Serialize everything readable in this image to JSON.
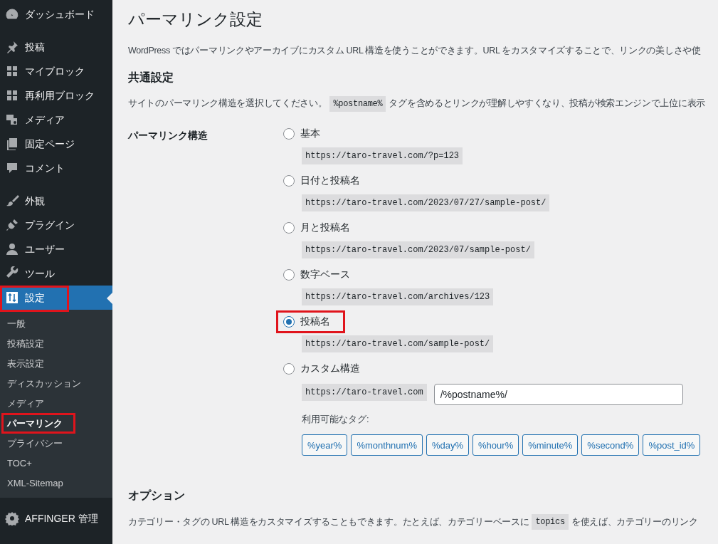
{
  "sidebar": {
    "groups": [
      [
        {
          "label": "ダッシュボード",
          "selected": false,
          "highlighted": false
        }
      ],
      [
        {
          "label": "投稿",
          "selected": false,
          "highlighted": false
        },
        {
          "label": "マイブロック",
          "selected": false,
          "highlighted": false
        },
        {
          "label": "再利用ブロック",
          "selected": false,
          "highlighted": false
        },
        {
          "label": "メディア",
          "selected": false,
          "highlighted": false
        },
        {
          "label": "固定ページ",
          "selected": false,
          "highlighted": false
        },
        {
          "label": "コメント",
          "selected": false,
          "highlighted": false
        }
      ],
      [
        {
          "label": "外観",
          "selected": false,
          "highlighted": false
        },
        {
          "label": "プラグイン",
          "selected": false,
          "highlighted": false
        },
        {
          "label": "ユーザー",
          "selected": false,
          "highlighted": false
        },
        {
          "label": "ツール",
          "selected": false,
          "highlighted": false
        },
        {
          "label": "設定",
          "selected": true,
          "highlighted": true,
          "submenu": [
            {
              "label": "一般",
              "selected": false,
              "highlighted": false
            },
            {
              "label": "投稿設定",
              "selected": false,
              "highlighted": false
            },
            {
              "label": "表示設定",
              "selected": false,
              "highlighted": false
            },
            {
              "label": "ディスカッション",
              "selected": false,
              "highlighted": false
            },
            {
              "label": "メディア",
              "selected": false,
              "highlighted": false
            },
            {
              "label": "パーマリンク",
              "selected": true,
              "highlighted": true
            },
            {
              "label": "プライバシー",
              "selected": false,
              "highlighted": false
            },
            {
              "label": "TOC+",
              "selected": false,
              "highlighted": false
            },
            {
              "label": "XML-Sitemap",
              "selected": false,
              "highlighted": false
            }
          ]
        }
      ],
      [
        {
          "label": "AFFINGER 管理",
          "selected": false,
          "highlighted": false
        }
      ]
    ]
  },
  "main": {
    "title": "パーマリンク設定",
    "intro": [
      {
        "kind": "text",
        "text": "WordPress ではパーマリンクやアーカイブにカスタム URL 構造を使うことができます。URL をカスタマイズすることで、リンクの美しさや使"
      }
    ],
    "common": {
      "heading": "共通設定",
      "description": [
        {
          "kind": "text",
          "text": "サイトのパーマリンク構造を選択してください。"
        },
        {
          "kind": "code",
          "text": "%postname%"
        },
        {
          "kind": "text",
          "text": "タグを含めるとリンクが理解しやすくなり、投稿が検索エンジンで上位に表示"
        }
      ],
      "field_label": "パーマリンク構造",
      "options": [
        {
          "kind": "preset",
          "label": "基本",
          "url": "https://taro-travel.com/?p=123",
          "selected": false,
          "highlighted": false
        },
        {
          "kind": "preset",
          "label": "日付と投稿名",
          "url": "https://taro-travel.com/2023/07/27/sample-post/",
          "selected": false,
          "highlighted": false
        },
        {
          "kind": "preset",
          "label": "月と投稿名",
          "url": "https://taro-travel.com/2023/07/sample-post/",
          "selected": false,
          "highlighted": false
        },
        {
          "kind": "preset",
          "label": "数字ベース",
          "url": "https://taro-travel.com/archives/123",
          "selected": false,
          "highlighted": false
        },
        {
          "kind": "preset",
          "label": "投稿名",
          "url": "https://taro-travel.com/sample-post/",
          "selected": true,
          "highlighted": true
        },
        {
          "kind": "custom",
          "label": "カスタム構造",
          "prefix": "https://taro-travel.com",
          "value": "/%postname%/",
          "tags_label": "利用可能なタグ:",
          "tags": [
            "%year%",
            "%monthnum%",
            "%day%",
            "%hour%",
            "%minute%",
            "%second%",
            "%post_id%"
          ],
          "selected": false,
          "highlighted": false
        }
      ]
    },
    "options_section": {
      "heading": "オプション",
      "description": [
        {
          "kind": "text",
          "text": "カテゴリー・タグの URL 構造をカスタマイズすることもできます。たとえば、カテゴリーベースに"
        },
        {
          "kind": "code",
          "text": "topics"
        },
        {
          "kind": "text",
          "text": "を使えば、カテゴリーのリンク"
        }
      ]
    }
  }
}
